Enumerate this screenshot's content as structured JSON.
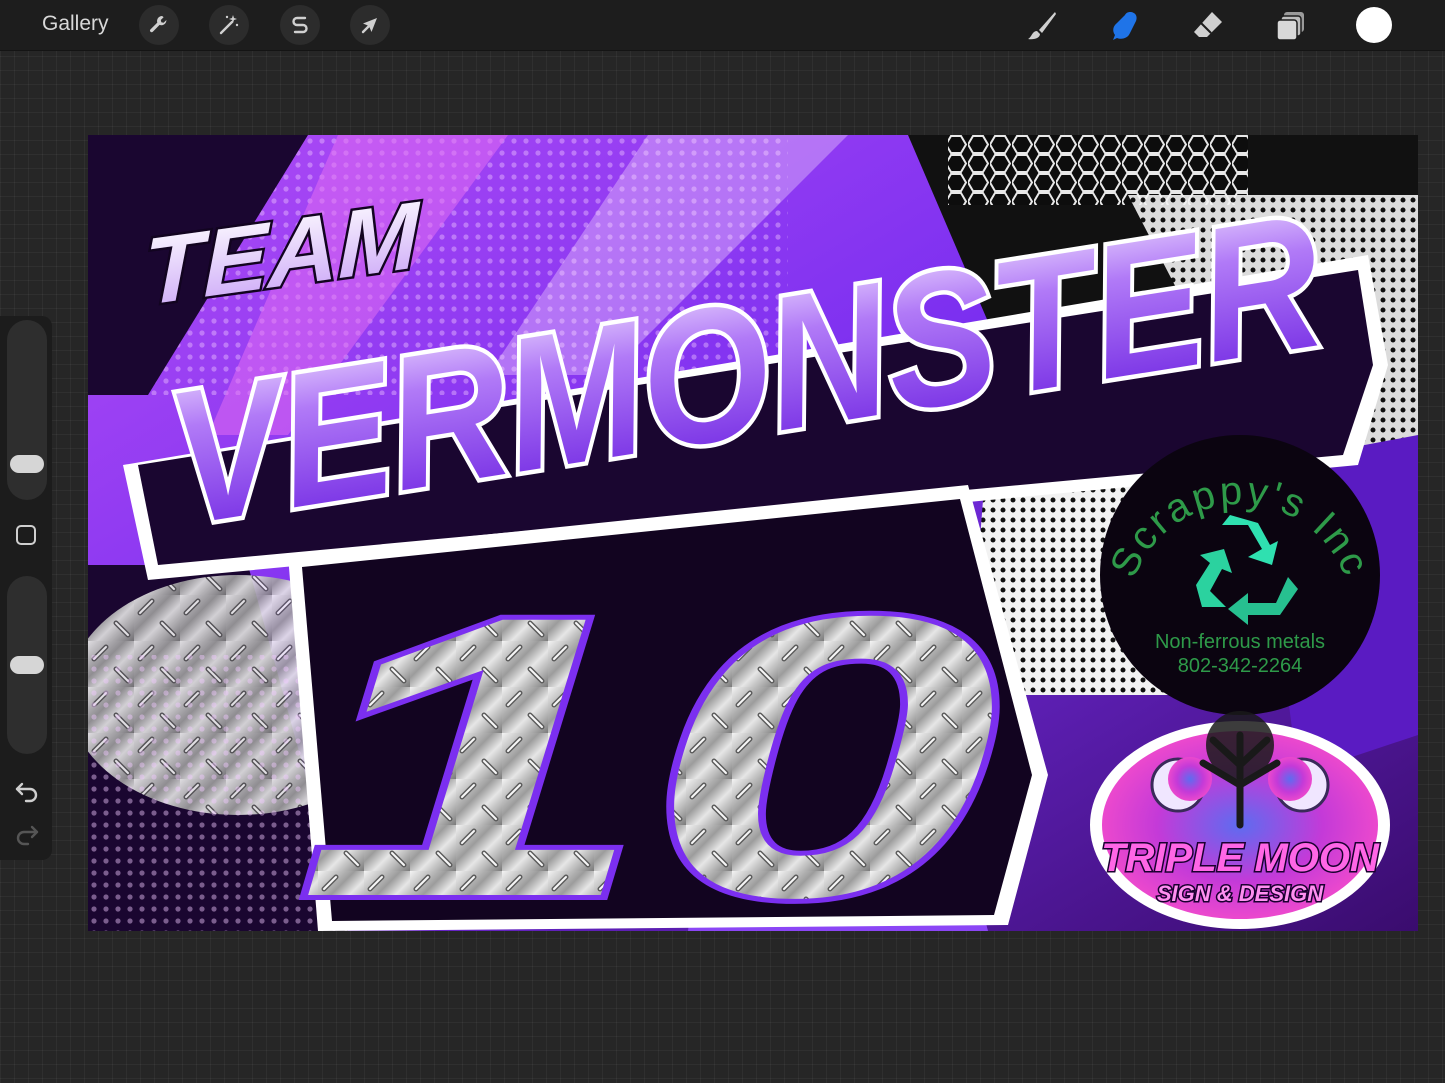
{
  "app": {
    "gallery_label": "Gallery"
  },
  "toolbar": {
    "left_tools": [
      {
        "name": "actions",
        "icon": "wrench-icon"
      },
      {
        "name": "adjustments",
        "icon": "magic-wand-icon"
      },
      {
        "name": "selection",
        "icon": "selection-s-icon"
      },
      {
        "name": "transform",
        "icon": "arrow-cursor-icon"
      }
    ],
    "right_tools": [
      {
        "name": "brush",
        "icon": "brush-icon",
        "active": false
      },
      {
        "name": "smudge",
        "icon": "smudge-finger-icon",
        "active": true
      },
      {
        "name": "eraser",
        "icon": "eraser-icon",
        "active": false
      },
      {
        "name": "layers",
        "icon": "layers-icon",
        "active": false
      }
    ],
    "active_color": "#ffffff",
    "accent_color": "#1f74e8"
  },
  "sidebar": {
    "brush_size_level": 0.15,
    "opacity_level": 0.5,
    "undo_icon": "undo-arrow-icon",
    "redo_icon": "redo-arrow-icon"
  },
  "artwork": {
    "title_small": "TEAM",
    "title_large": "VERMONSTER",
    "number": "10",
    "sponsor": {
      "name": "Scrappy's Inc",
      "line1": "Non-ferrous metals",
      "line2": "802-342-2264",
      "icon": "recycle-icon"
    },
    "designer_logo": {
      "line1": "TRIPLE MOON",
      "line2": "SIGN & DESIGN"
    },
    "colors": {
      "purple": "#7b2ff0",
      "pink": "#e85cf0",
      "sponsor_green": "#2e9a49",
      "recycle_teal": "#2fe0b0"
    }
  }
}
